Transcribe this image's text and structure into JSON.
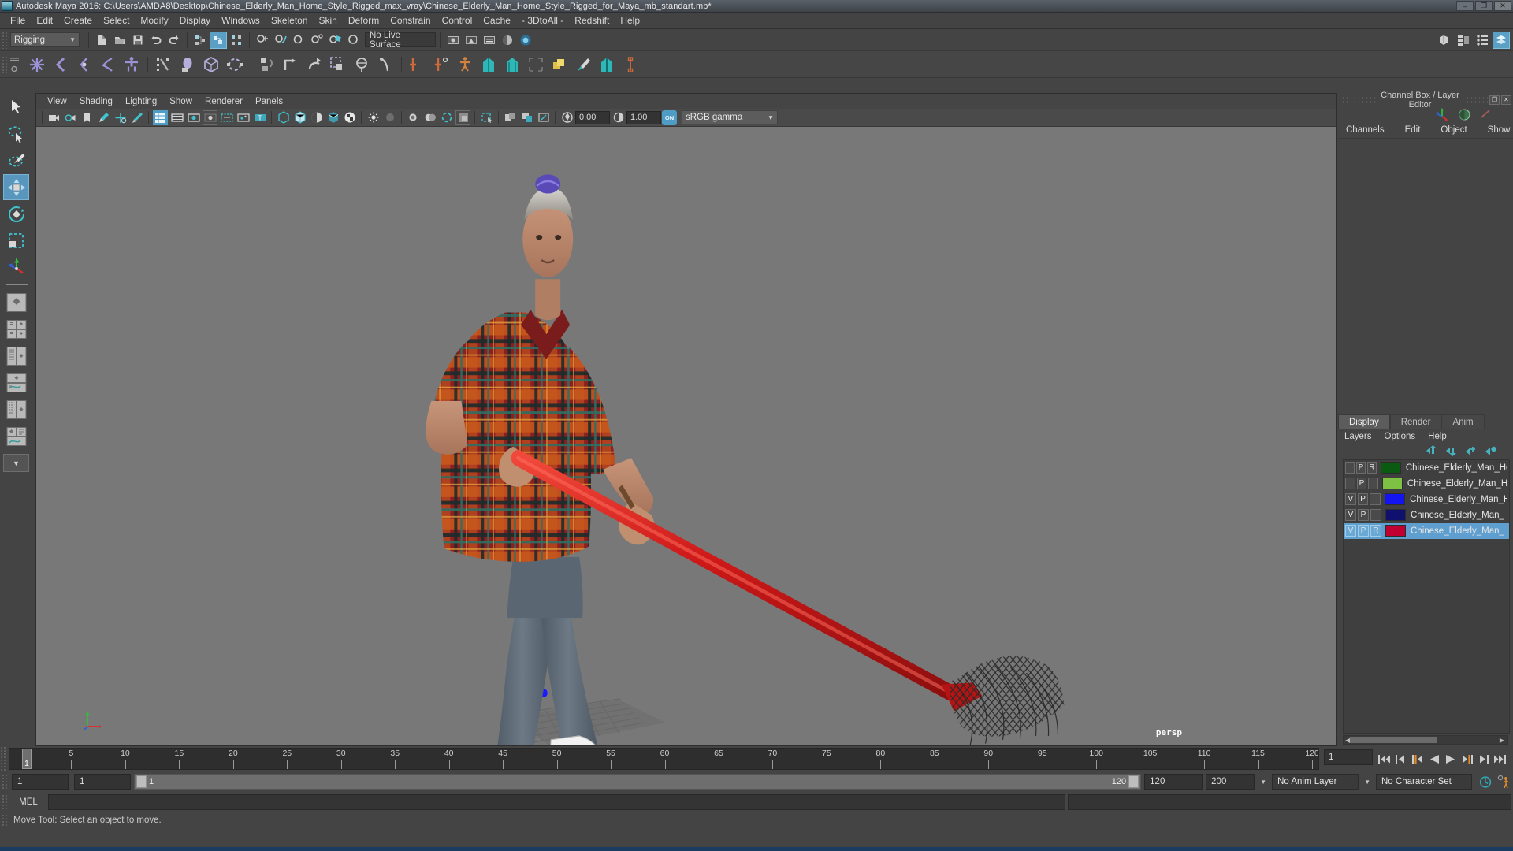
{
  "window": {
    "title": "Autodesk Maya 2016: C:\\Users\\AMDA8\\Desktop\\Chinese_Elderly_Man_Home_Style_Rigged_max_vray\\Chinese_Elderly_Man_Home_Style_Rigged_for_Maya_mb_standart.mb*",
    "minimize": "–",
    "maximize": "❐",
    "close": "✕"
  },
  "menubar": {
    "items": [
      {
        "label": "File"
      },
      {
        "label": "Edit"
      },
      {
        "label": "Create"
      },
      {
        "label": "Select"
      },
      {
        "label": "Modify"
      },
      {
        "label": "Display"
      },
      {
        "label": "Windows"
      },
      {
        "label": "Skeleton"
      },
      {
        "label": "Skin"
      },
      {
        "label": "Deform"
      },
      {
        "label": "Constrain"
      },
      {
        "label": "Control"
      },
      {
        "label": "Cache"
      },
      {
        "label": "- 3DtoAll -"
      },
      {
        "label": "Redshift"
      },
      {
        "label": "Help"
      }
    ]
  },
  "statusline": {
    "menuset": "Rigging",
    "live_surface": "No Live Surface",
    "icons": [
      "new-scene-icon",
      "open-scene-icon",
      "save-scene-icon",
      "undo-icon",
      "redo-icon",
      "select-by-hierarchy-icon",
      "select-by-object-icon",
      "select-by-component-icon",
      "snap-to-grid-icon",
      "snap-to-curve-icon",
      "snap-to-point-icon",
      "snap-to-projected-center-icon",
      "snap-to-view-plane-icon",
      "make-live-icon",
      "show-hide-editors-icon",
      "show-hide-attribute-editor-icon",
      "show-hide-tool-settings-icon",
      "show-hide-channel-box-icon"
    ]
  },
  "shelf": {
    "tab": "Rigging",
    "icons": [
      "joint-tool-icon",
      "ik-handle-tool-icon",
      "ik-spline-handle-icon",
      "ik-rp-solver-icon",
      "quick-rig-icon",
      "bind-skin-icon",
      "interactive-bind-icon",
      "smooth-bind-icon",
      "detach-skin-icon",
      "parent-constraint-icon",
      "point-constraint-icon",
      "orient-constraint-icon",
      "scale-constraint-icon",
      "aim-constraint-icon",
      "pole-vector-icon",
      "create-deformer-icon",
      "blend-shape-icon",
      "human-ik-icon",
      "character-icon",
      "character-set-icon",
      "duplicate-special-icon",
      "paint-weights-icon",
      "mirror-skin-icon",
      "measure-tool-icon"
    ]
  },
  "toolbox": {
    "items": [
      {
        "name": "select-tool",
        "active": false
      },
      {
        "name": "lasso-select-tool",
        "active": false
      },
      {
        "name": "paint-select-tool",
        "active": false
      },
      {
        "name": "move-tool",
        "active": true
      },
      {
        "name": "rotate-tool",
        "active": false
      },
      {
        "name": "scale-tool",
        "active": false
      },
      {
        "name": "last-tool-used",
        "active": false
      }
    ],
    "layouts": [
      "single-perspective-layout",
      "four-view-layout",
      "outliner-persp-layout",
      "persp-graph-editor-layout",
      "hypershade-persp-layout",
      "persp-outliner-graph-layout"
    ]
  },
  "viewport": {
    "menu": [
      "View",
      "Shading",
      "Lighting",
      "Show",
      "Renderer",
      "Panels"
    ],
    "camera_label": "persp",
    "exposure": "0.00",
    "gamma": "1.00",
    "color_mode": "sRGB gamma",
    "view_toggle_on": "ON",
    "icons": [
      "select-camera-icon",
      "camera-attributes-icon",
      "bookmark-icon",
      "image-plane-icon",
      "two-d-pan-zoom-icon",
      "grease-pencil-icon",
      "grid-toggle-icon",
      "film-gate-icon",
      "resolution-gate-icon",
      "gate-mask-icon",
      "film-origin-icon",
      "xray-joints-icon",
      "texture-icon",
      "wireframe-icon",
      "smooth-shade-icon",
      "shaded-wireframe-icon",
      "textured-icon",
      "light-shading-icon",
      "shadows-icon",
      "ambient-occlusion-icon",
      "motion-blur-icon",
      "multisample-icon",
      "isolate-select-icon",
      "xray-icon",
      "xray-active-components-icon",
      "bake-icon"
    ]
  },
  "channel_box": {
    "title": "Channel Box / Layer Editor",
    "tabs": [
      "Channels",
      "Edit",
      "Object",
      "Show"
    ],
    "panel_icons": [
      "move-axis-icon",
      "channel-box-icon",
      "layer-editor-icon"
    ],
    "restore_glyph": "❐",
    "close_glyph": "✕"
  },
  "layer_editor": {
    "tabs": [
      {
        "label": "Display",
        "selected": true
      },
      {
        "label": "Render",
        "selected": false
      },
      {
        "label": "Anim",
        "selected": false
      }
    ],
    "menu": [
      "Layers",
      "Options",
      "Help"
    ],
    "buttons": [
      "move-layer-up-icon",
      "move-layer-down-icon",
      "new-layer-icon",
      "new-layer-from-selected-icon"
    ],
    "layers": [
      {
        "v": "",
        "p": "P",
        "r": "R",
        "color": "#0a5a12",
        "name": "Chinese_Elderly_Man_Home_",
        "selected": false
      },
      {
        "v": "",
        "p": "P",
        "r": "",
        "color": "#7dc242",
        "name": "Chinese_Elderly_Man_Hom",
        "selected": false
      },
      {
        "v": "V",
        "p": "P",
        "r": "",
        "color": "#1414f0",
        "name": "Chinese_Elderly_Man_H",
        "selected": false
      },
      {
        "v": "V",
        "p": "P",
        "r": "",
        "color": "#10106e",
        "name": "Chinese_Elderly_Man_",
        "selected": false
      },
      {
        "v": "V",
        "p": "P",
        "r": "R",
        "color": "#c00030",
        "name": "Chinese_Elderly_Man_",
        "selected": true
      }
    ]
  },
  "timeline": {
    "ticks": [
      5,
      10,
      15,
      20,
      25,
      30,
      35,
      40,
      45,
      50,
      55,
      60,
      65,
      70,
      75,
      80,
      85,
      90,
      95,
      100,
      105,
      110,
      115,
      120
    ],
    "current_frame": "1",
    "playhead_label": "1",
    "range_start": "1",
    "range_end": "1",
    "anim_start": "120",
    "anim_end": "200",
    "range_bar_left": "1",
    "range_bar_right": "120",
    "current_frame_field": "1",
    "anim_layer": "No Anim Layer",
    "character_set": "No Character Set",
    "playback_icons": [
      "go-to-start-icon",
      "step-back-frame-icon",
      "step-back-key-icon",
      "play-backwards-icon",
      "play-forwards-icon",
      "step-forward-key-icon",
      "step-forward-frame-icon",
      "go-to-end-icon"
    ],
    "right_icons": [
      "auto-key-icon",
      "animation-preferences-icon"
    ]
  },
  "command_line": {
    "label": "MEL",
    "input_value": "",
    "result_value": ""
  },
  "help_line": {
    "text": "Move Tool: Select an object to move."
  },
  "colors": {
    "accent": "#5896bd",
    "panel_bg": "#444444",
    "viewport_bg": "#787878",
    "toolbar_bg": "#464646"
  }
}
